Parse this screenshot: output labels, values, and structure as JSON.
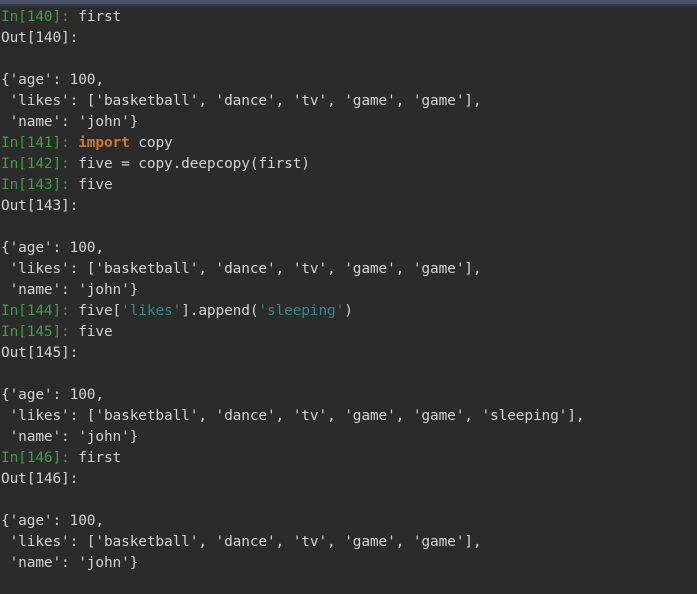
{
  "window": {
    "title_strip_color": "#4a5068",
    "background_color": "#2b2b2b"
  },
  "theme": {
    "background": "#2b2b2b",
    "foreground": "#d2d2d2",
    "prompt_in": "#3f9e3f",
    "prompt_out": "#d2d2d2",
    "keyword": "#cc7832",
    "string": "#2e8b87"
  },
  "session": {
    "lines": [
      {
        "kind": "input",
        "prompt": "In[140]:",
        "code_parts": [
          {
            "t": "plain",
            "v": " first"
          }
        ]
      },
      {
        "kind": "output_prompt",
        "text": "Out[140]:"
      },
      {
        "kind": "blank",
        "text": ""
      },
      {
        "kind": "output",
        "text": "{'age': 100,"
      },
      {
        "kind": "output",
        "text": " 'likes': ['basketball', 'dance', 'tv', 'game', 'game'],"
      },
      {
        "kind": "output",
        "text": " 'name': 'john'}"
      },
      {
        "kind": "input",
        "prompt": "In[141]:",
        "code_parts": [
          {
            "t": "kw",
            "v": " import"
          },
          {
            "t": "plain",
            "v": " copy"
          }
        ]
      },
      {
        "kind": "input",
        "prompt": "In[142]:",
        "code_parts": [
          {
            "t": "plain",
            "v": " five = copy.deepcopy(first)"
          }
        ]
      },
      {
        "kind": "input",
        "prompt": "In[143]:",
        "code_parts": [
          {
            "t": "plain",
            "v": " five"
          }
        ]
      },
      {
        "kind": "output_prompt",
        "text": "Out[143]:"
      },
      {
        "kind": "blank",
        "text": ""
      },
      {
        "kind": "output",
        "text": "{'age': 100,"
      },
      {
        "kind": "output",
        "text": " 'likes': ['basketball', 'dance', 'tv', 'game', 'game'],"
      },
      {
        "kind": "output",
        "text": " 'name': 'john'}"
      },
      {
        "kind": "input",
        "prompt": "In[144]:",
        "code_parts": [
          {
            "t": "plain",
            "v": " five["
          },
          {
            "t": "str",
            "v": "'likes'"
          },
          {
            "t": "plain",
            "v": "].append("
          },
          {
            "t": "str",
            "v": "'sleeping'"
          },
          {
            "t": "plain",
            "v": ")"
          }
        ]
      },
      {
        "kind": "input",
        "prompt": "In[145]:",
        "code_parts": [
          {
            "t": "plain",
            "v": " five"
          }
        ]
      },
      {
        "kind": "output_prompt",
        "text": "Out[145]:"
      },
      {
        "kind": "blank",
        "text": ""
      },
      {
        "kind": "output",
        "text": "{'age': 100,"
      },
      {
        "kind": "output",
        "text": " 'likes': ['basketball', 'dance', 'tv', 'game', 'game', 'sleeping'],"
      },
      {
        "kind": "output",
        "text": " 'name': 'john'}"
      },
      {
        "kind": "input",
        "prompt": "In[146]:",
        "code_parts": [
          {
            "t": "plain",
            "v": " first"
          }
        ]
      },
      {
        "kind": "output_prompt",
        "text": "Out[146]:"
      },
      {
        "kind": "blank",
        "text": ""
      },
      {
        "kind": "output",
        "text": "{'age': 100,"
      },
      {
        "kind": "output",
        "text": " 'likes': ['basketball', 'dance', 'tv', 'game', 'game'],"
      },
      {
        "kind": "output",
        "text": " 'name': 'john'}"
      }
    ]
  }
}
